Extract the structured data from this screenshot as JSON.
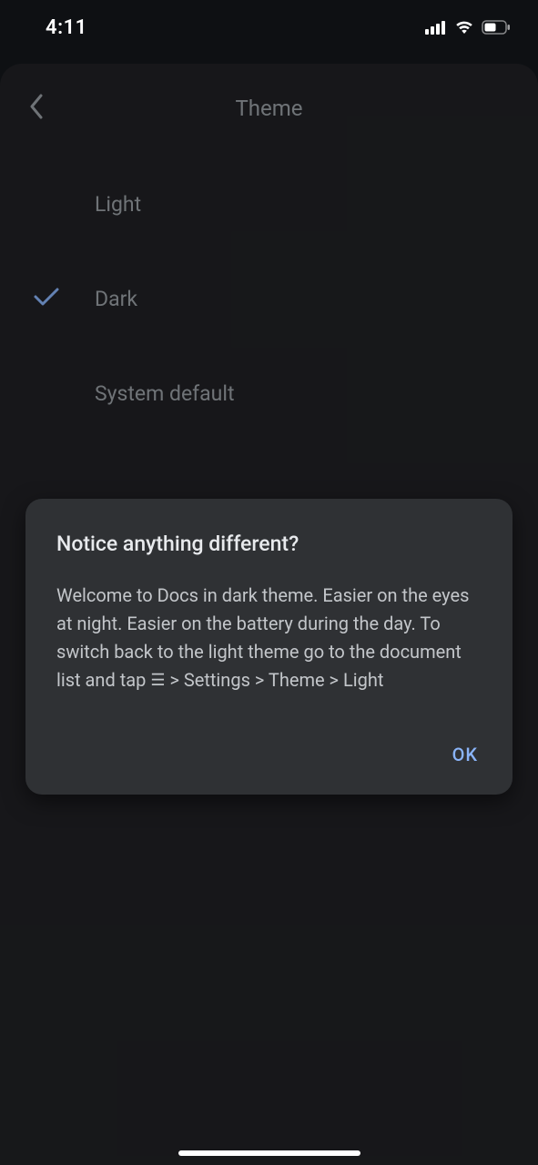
{
  "status_bar": {
    "time": "4:11"
  },
  "header": {
    "title": "Theme"
  },
  "options": [
    {
      "label": "Light",
      "selected": false
    },
    {
      "label": "Dark",
      "selected": true
    },
    {
      "label": "System default",
      "selected": false
    }
  ],
  "dialog": {
    "title": "Notice anything different?",
    "body_before": "Welcome to Docs in dark theme. Easier on the eyes at night. Easier on the battery during the day. To switch back to the light theme go to the document list and tap ",
    "body_after": " > Settings > Theme > Light",
    "ok_label": "OK"
  },
  "colors": {
    "accent": "#8ab4f8",
    "sheet_bg": "#202124",
    "dialog_bg": "#2f3134"
  }
}
